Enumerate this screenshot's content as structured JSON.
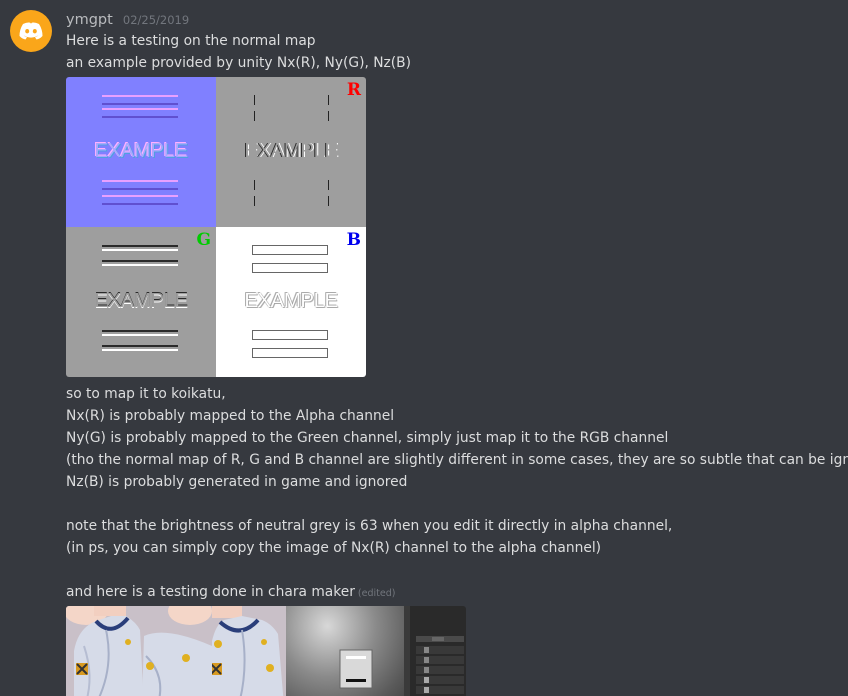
{
  "message": {
    "author": "ymgpt",
    "timestamp": "02/25/2019",
    "lines_intro": [
      "Here is a testing on the normal map",
      "an example provided by unity Nx(R), Ny(G), Nz(B)"
    ],
    "lines_mapping": [
      "so to map it to koikatu,",
      "Nx(R) is probably mapped to the Alpha channel",
      "Ny(G) is probably mapped to the Green channel, simply just map it to the RGB channel",
      "(tho the normal map of R, G and B channel are slightly different in some cases, they are so subtle that can be ignored)",
      "Nz(B) is probably generated in game and ignored"
    ],
    "lines_note": [
      "note that the brightness of neutral grey is 63 when you edit it directly in alpha channel,",
      "(in ps, you can simply copy the image of Nx(R) channel to the alpha channel)"
    ],
    "last_line": "and here is a testing done in chara maker",
    "edited_label": "(edited)"
  },
  "normal_map_image": {
    "example_text": "EXAMPLE",
    "channel_labels": {
      "r": "R",
      "g": "G",
      "b": "B"
    },
    "colors": {
      "normal": "#8080ff",
      "grey": "#9e9e9e",
      "white": "#ffffff",
      "r": "#ff0000",
      "g": "#00cc00",
      "b": "#0000ee"
    }
  },
  "colors": {
    "background": "#36393f",
    "avatar": "#faa61a",
    "username": "#b9bbbe",
    "text": "#dcddde",
    "muted": "#72767d"
  },
  "icons": {
    "avatar": "discord-logo-icon"
  }
}
